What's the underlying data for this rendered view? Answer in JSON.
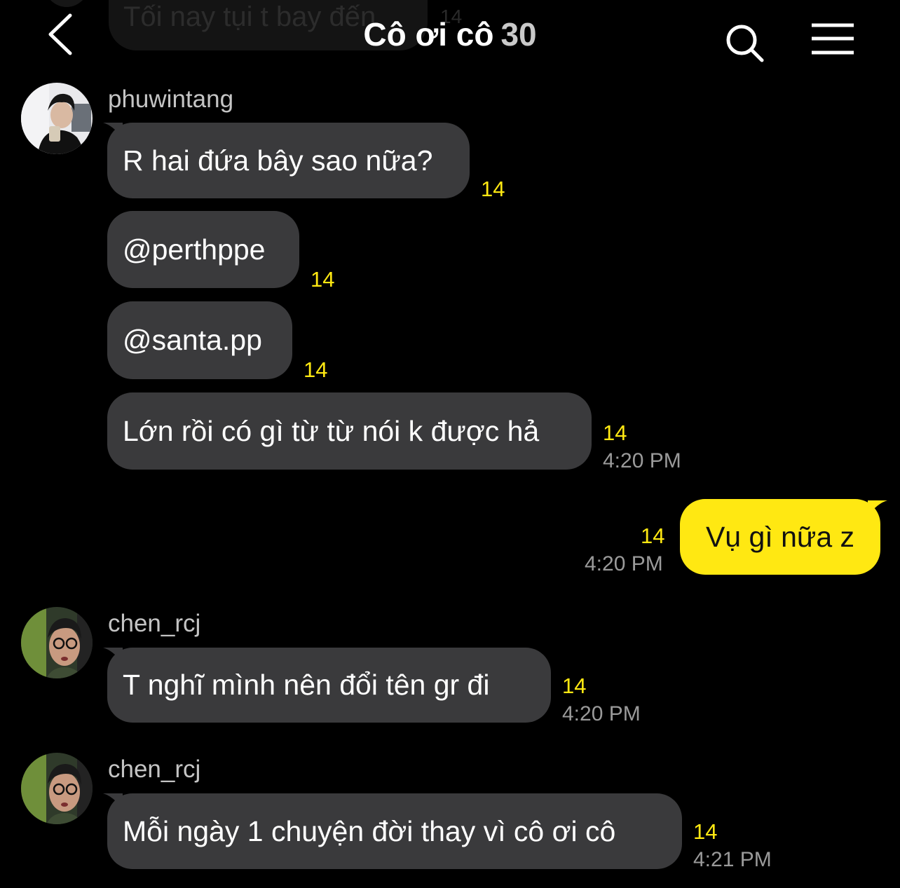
{
  "header": {
    "title": "Cô ơi cô",
    "member_count": "30",
    "back_icon": "chevron-left-icon",
    "search_icon": "search-icon",
    "menu_icon": "hamburger-menu-icon"
  },
  "previous_message": {
    "text": "Tối nay tụi t bay đến",
    "unread": "14"
  },
  "messages": [
    {
      "sender": "phuwintang",
      "bubbles": [
        {
          "text": "R hai đứa bây sao nữa?",
          "unread": "14"
        },
        {
          "text": "@perthppe",
          "unread": "14"
        },
        {
          "text": "@santa.pp",
          "unread": "14"
        },
        {
          "text": "Lớn rồi có gì từ từ nói k được hả",
          "unread": "14",
          "time": "4:20 PM"
        }
      ]
    },
    {
      "sender": "me",
      "bubbles": [
        {
          "text": "Vụ gì nữa z",
          "unread": "14",
          "time": "4:20 PM"
        }
      ]
    },
    {
      "sender": "chen_rcj",
      "bubbles": [
        {
          "text": "T nghĩ mình nên đổi tên gr đi",
          "unread": "14",
          "time": "4:20 PM"
        }
      ]
    },
    {
      "sender": "chen_rcj",
      "bubbles": [
        {
          "text": "Mỗi ngày 1 chuyện đời thay vì cô ơi cô",
          "unread": "14",
          "time": "4:21 PM"
        }
      ]
    }
  ],
  "colors": {
    "background": "#000000",
    "bubble_other": "#3a3a3c",
    "bubble_mine": "#ffe812",
    "unread_count": "#ffe812",
    "timestamp": "#9a9a9a"
  }
}
